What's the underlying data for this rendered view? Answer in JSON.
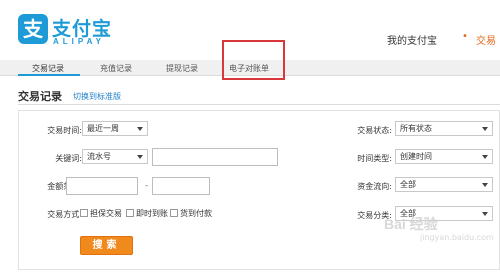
{
  "header": {
    "logo_glyph": "支",
    "logo_cn": "支付宝",
    "logo_en": "ALIPAY",
    "nav_my": "我的支付宝",
    "nav_trade_dot": "•",
    "nav_trade": "交易"
  },
  "tabs": [
    {
      "label": "交易记录",
      "active": true
    },
    {
      "label": "充值记录",
      "active": false
    },
    {
      "label": "提现记录",
      "active": false
    },
    {
      "label": "电子对账单",
      "active": false
    }
  ],
  "section": {
    "title": "交易记录",
    "switch_link": "切换到标准版"
  },
  "form": {
    "time_label": "交易时间:",
    "time_value": "最近一周",
    "keyword_label": "关键词:",
    "keyword_type": "流水号",
    "amount_label": "金额范围:",
    "amount_dash": "-",
    "method_label": "交易方式:",
    "method_options": [
      "担保交易",
      "即时到账",
      "货到付款"
    ],
    "status_label": "交易状态:",
    "status_value": "所有状态",
    "time_type_label": "时间类型:",
    "time_type_value": "创建时间",
    "fund_label": "资金流向:",
    "fund_value": "全部",
    "category_label": "交易分类:",
    "category_value": "全部",
    "search_button": "搜索"
  },
  "watermark": {
    "main": "Bai 经验",
    "sub": "jingyan.baidu.com"
  },
  "colors": {
    "brand": "#1e9bd7",
    "accent": "#e36a1b",
    "button": "#f08a1d",
    "highlight": "#d9383a"
  }
}
